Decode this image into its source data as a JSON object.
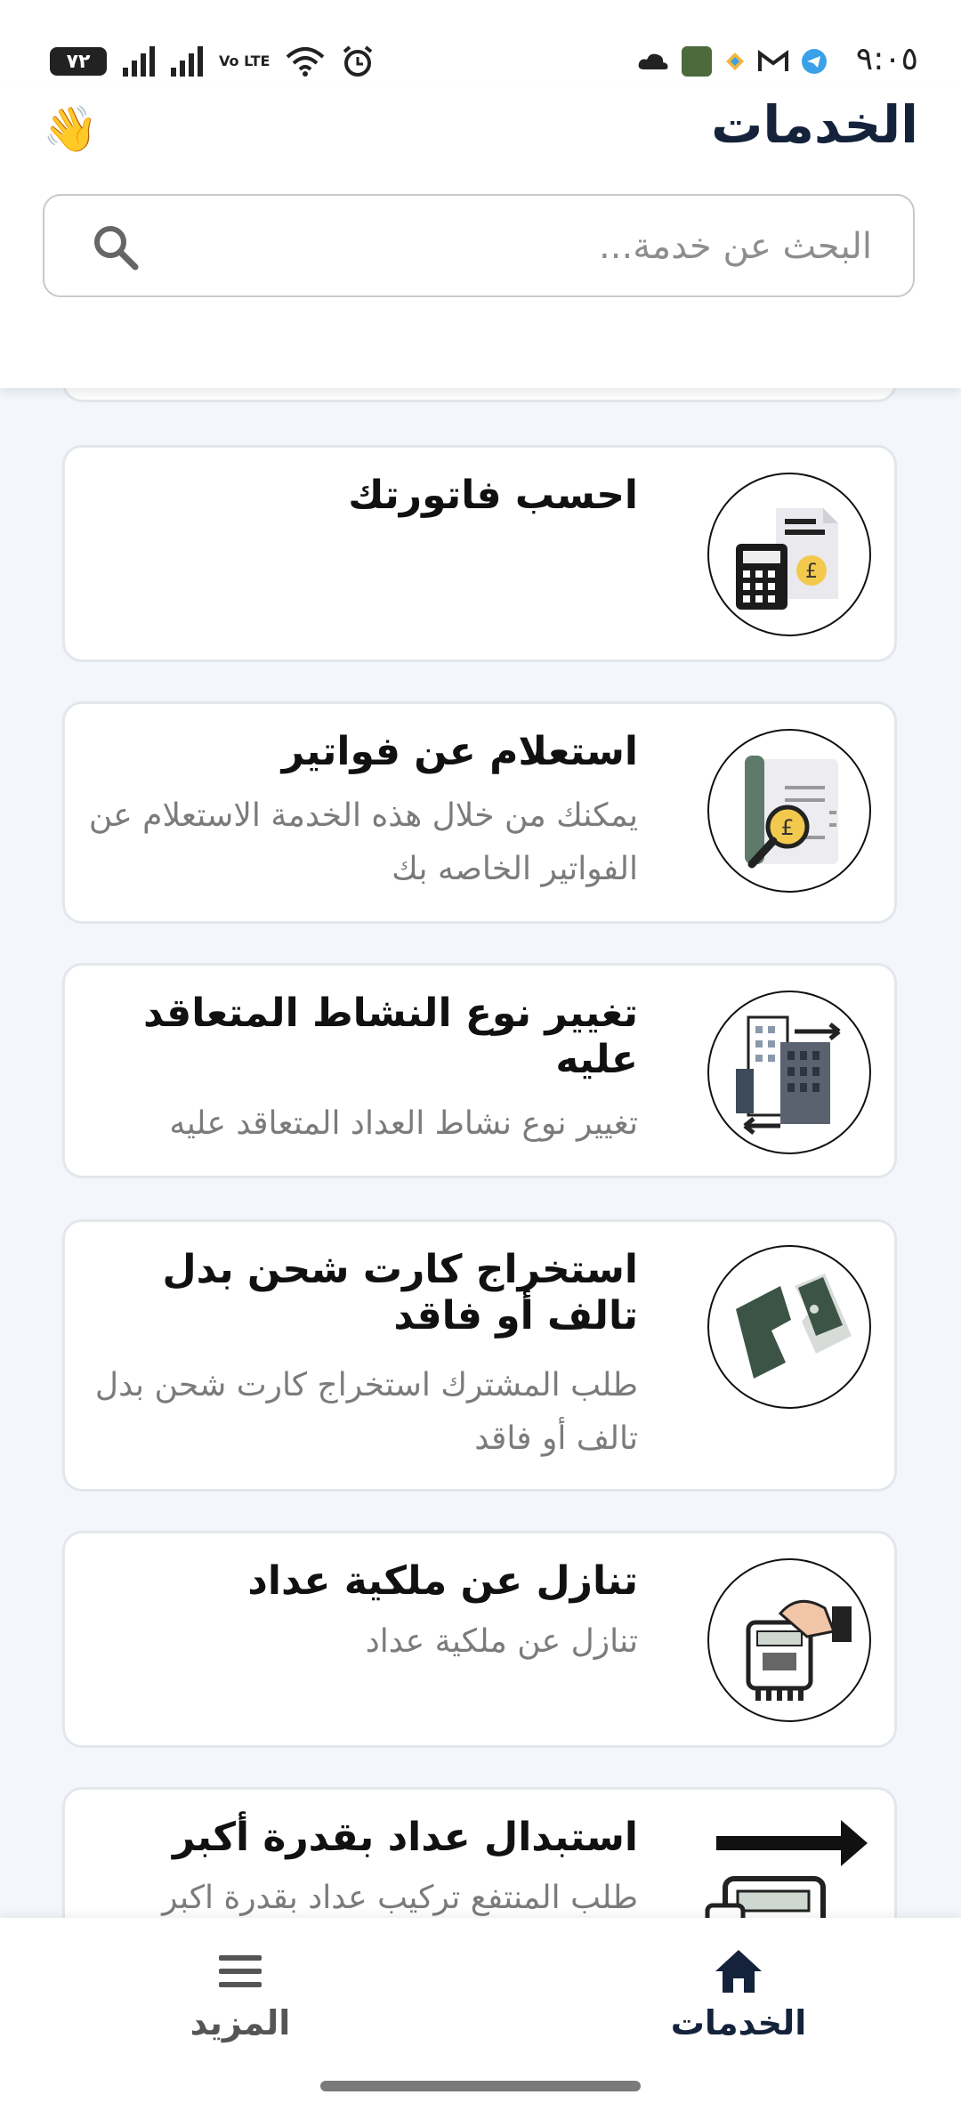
{
  "status_bar": {
    "time": "٩:٠٥",
    "battery": "٧٢",
    "network": "Vo LTE"
  },
  "header": {
    "title": "الخدمات",
    "wave_emoji": "👋"
  },
  "search": {
    "placeholder": "البحث عن خدمة..."
  },
  "services": [
    {
      "title": "احسب فاتورتك",
      "description": "",
      "icon": "calculator-bill-icon"
    },
    {
      "title": "استعلام عن فواتير",
      "description": "يمكنك من خلال هذه الخدمة الاستعلام عن الفواتير الخاصه بك",
      "icon": "invoice-search-icon"
    },
    {
      "title": "تغيير نوع النشاط المتعاقد عليه",
      "description": "تغيير نوع نشاط العداد المتعاقد عليه",
      "icon": "buildings-exchange-icon"
    },
    {
      "title": "استخراج كارت شحن بدل تالف أو فاقد",
      "description": "طلب المشترك استخراج كارت شحن بدل تالف أو فاقد",
      "icon": "broken-card-icon"
    },
    {
      "title": "تنازل عن ملكية عداد",
      "description": "تنازل عن ملكية عداد",
      "icon": "meter-handover-icon"
    },
    {
      "title": "استبدال عداد بقدرة أكبر",
      "description": "طلب المنتفع تركيب عداد بقدرة اكبر",
      "icon": "meter-upgrade-icon"
    }
  ],
  "bottom_nav": {
    "services_label": "الخدمات",
    "more_label": "المزيد"
  },
  "colors": {
    "primary": "#14233b",
    "background": "#f3f7fb",
    "card_border": "#e3e7ec"
  }
}
